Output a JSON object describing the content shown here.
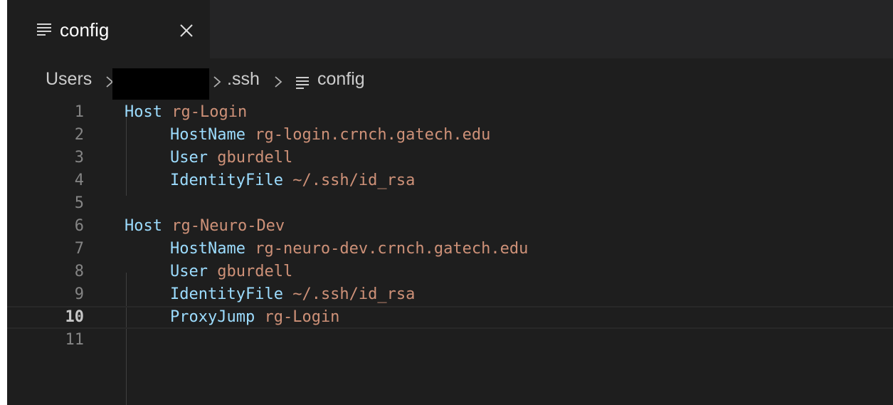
{
  "tab": {
    "label": "config",
    "icon": "lines-icon",
    "close_icon": "close-icon"
  },
  "breadcrumb": {
    "items": [
      "Users",
      ".ssh",
      "config"
    ]
  },
  "editor": {
    "active_line": 10,
    "lines": [
      {
        "num": "1",
        "key": "Host",
        "value": "rg-Login",
        "indent": 0
      },
      {
        "num": "2",
        "key": "HostName",
        "value": "rg-login.crnch.gatech.edu",
        "indent": 1
      },
      {
        "num": "3",
        "key": "User",
        "value": "gburdell",
        "indent": 1
      },
      {
        "num": "4",
        "key": "IdentityFile",
        "value": "~/.ssh/id_rsa",
        "indent": 1
      },
      {
        "num": "5",
        "key": "",
        "value": "",
        "indent": 0
      },
      {
        "num": "6",
        "key": "Host",
        "value": "rg-Neuro-Dev",
        "indent": 0
      },
      {
        "num": "7",
        "key": "HostName",
        "value": "rg-neuro-dev.crnch.gatech.edu",
        "indent": 1
      },
      {
        "num": "8",
        "key": "User",
        "value": "gburdell",
        "indent": 1
      },
      {
        "num": "9",
        "key": "IdentityFile",
        "value": "~/.ssh/id_rsa",
        "indent": 1
      },
      {
        "num": "10",
        "key": "ProxyJump",
        "value": "rg-Login",
        "indent": 1
      },
      {
        "num": "11",
        "key": "",
        "value": "",
        "indent": 0
      }
    ]
  },
  "colors": {
    "keyword": "#9cdcfe",
    "value": "#ce9178",
    "line_number": "#858585",
    "background": "#1e1e1e"
  }
}
